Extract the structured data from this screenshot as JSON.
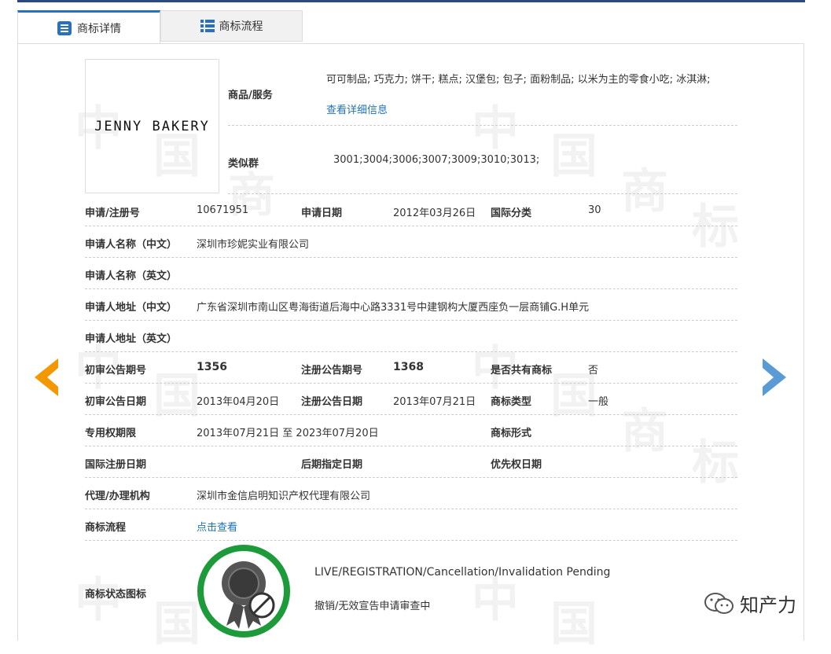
{
  "tabs": {
    "detail": "商标详情",
    "flow": "商标流程"
  },
  "logo_text": "JENNY BAKERY",
  "goods": {
    "label": "商品/服务",
    "value": "可可制品; 巧克力; 饼干; 糕点; 汉堡包; 包子; 面粉制品; 以米为主的零食小吃; 冰淇淋;",
    "link": "查看详细信息"
  },
  "similar": {
    "label": "类似群",
    "value": "3001;3004;3006;3007;3009;3010;3013;"
  },
  "reg_no": {
    "label": "申请/注册号",
    "value": "10671951"
  },
  "apply_date": {
    "label": "申请日期",
    "value": "2012年03月26日"
  },
  "intl_class": {
    "label": "国际分类",
    "value": "30"
  },
  "applicant_cn": {
    "label": "申请人名称（中文）",
    "value": "深圳市珍妮实业有限公司"
  },
  "applicant_en": {
    "label": "申请人名称（英文）",
    "value": ""
  },
  "address_cn": {
    "label": "申请人地址（中文）",
    "value": "广东省深圳市南山区粤海街道后海中心路3331号中建钢构大厦西座负一层商铺G.H单元"
  },
  "address_en": {
    "label": "申请人地址（英文）",
    "value": ""
  },
  "prelim_no": {
    "label": "初审公告期号",
    "value": "1356"
  },
  "reg_pub_no": {
    "label": "注册公告期号",
    "value": "1368"
  },
  "shared": {
    "label": "是否共有商标",
    "value": "否"
  },
  "prelim_date": {
    "label": "初审公告日期",
    "value": "2013年04月20日"
  },
  "reg_pub_date": {
    "label": "注册公告日期",
    "value": "2013年07月21日"
  },
  "tm_type": {
    "label": "商标类型",
    "value": "一般"
  },
  "exclusive": {
    "label": "专用权期限",
    "value": "2013年07月21日 至 2023年07月20日"
  },
  "tm_form": {
    "label": "商标形式",
    "value": ""
  },
  "intl_reg_date": {
    "label": "国际注册日期",
    "value": ""
  },
  "later_date": {
    "label": "后期指定日期",
    "value": ""
  },
  "priority_date": {
    "label": "优先权日期",
    "value": ""
  },
  "agent": {
    "label": "代理/办理机构",
    "value": "深圳市金信启明知识产权代理有限公司"
  },
  "flow": {
    "label": "商标流程",
    "link": "点击查看"
  },
  "status": {
    "label": "商标状态图标",
    "en": "LIVE/REGISTRATION/Cancellation/Invalidation Pending",
    "cn": "撤销/无效宣告申请审查中"
  },
  "watermark": {
    "text": "知产力"
  },
  "colors": {
    "accent": "#2a70c0",
    "link": "#1f72b8",
    "prev_arrow": "#f39800",
    "next_arrow": "#5b9bd5",
    "badge_ring": "#1d9a3a"
  }
}
